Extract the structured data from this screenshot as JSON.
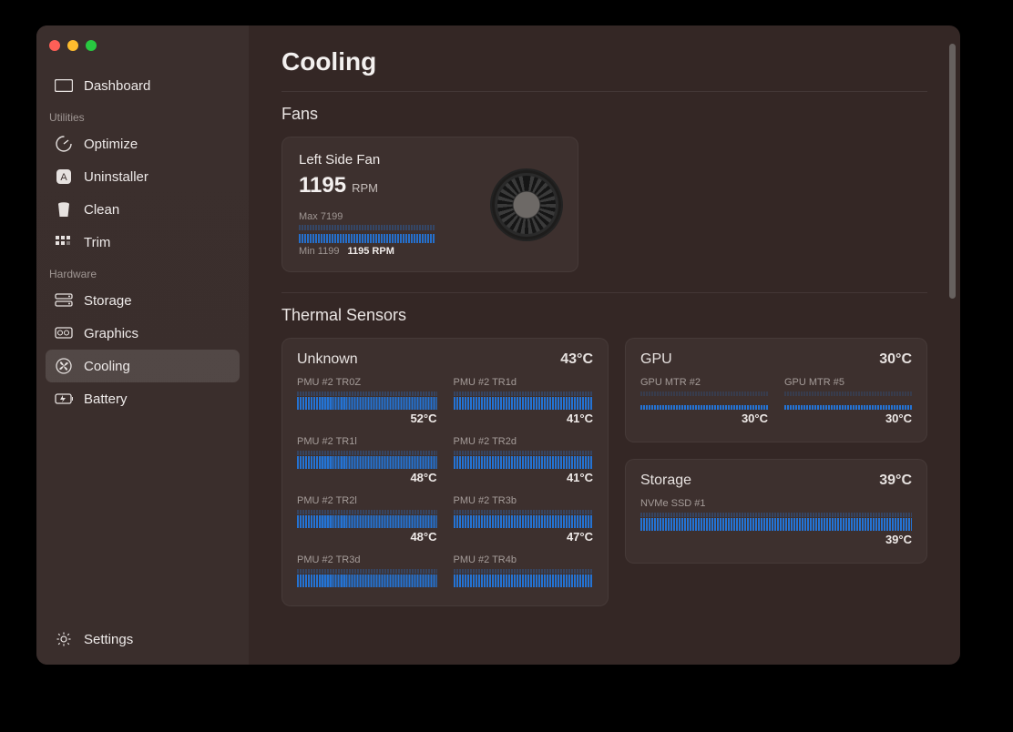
{
  "page": {
    "title": "Cooling"
  },
  "sidebar": {
    "top": {
      "label": "Dashboard"
    },
    "sect_utilities": "Utilities",
    "sect_hardware": "Hardware",
    "items": {
      "optimize": {
        "label": "Optimize"
      },
      "uninstaller": {
        "label": "Uninstaller"
      },
      "clean": {
        "label": "Clean"
      },
      "trim": {
        "label": "Trim"
      },
      "storage": {
        "label": "Storage"
      },
      "graphics": {
        "label": "Graphics"
      },
      "cooling": {
        "label": "Cooling"
      },
      "battery": {
        "label": "Battery"
      }
    },
    "settings": {
      "label": "Settings"
    }
  },
  "fans": {
    "heading": "Fans",
    "left": {
      "name": "Left Side Fan",
      "rpm_value": "1195",
      "rpm_unit": "RPM",
      "max_label": "Max 7199",
      "min_label": "Min 1199",
      "current_label": "1195 RPM"
    }
  },
  "thermal": {
    "heading": "Thermal Sensors",
    "groups": {
      "unknown": {
        "name": "Unknown",
        "temp": "43°C",
        "sensors": [
          {
            "name": "PMU #2 TR0Z",
            "temp": "52°C"
          },
          {
            "name": "PMU #2 TR1d",
            "temp": "41°C"
          },
          {
            "name": "PMU #2 TR1l",
            "temp": "48°C"
          },
          {
            "name": "PMU #2 TR2d",
            "temp": "41°C"
          },
          {
            "name": "PMU #2 TR2l",
            "temp": "48°C"
          },
          {
            "name": "PMU #2 TR3b",
            "temp": "47°C"
          },
          {
            "name": "PMU #2 TR3d",
            "temp": ""
          },
          {
            "name": "PMU #2 TR4b",
            "temp": ""
          }
        ]
      },
      "gpu": {
        "name": "GPU",
        "temp": "30°C",
        "sensors": [
          {
            "name": "GPU MTR #2",
            "temp": "30°C"
          },
          {
            "name": "GPU MTR #5",
            "temp": "30°C"
          }
        ]
      },
      "storage": {
        "name": "Storage",
        "temp": "39°C",
        "sensors": [
          {
            "name": "NVMe SSD #1",
            "temp": "39°C"
          }
        ]
      }
    }
  }
}
